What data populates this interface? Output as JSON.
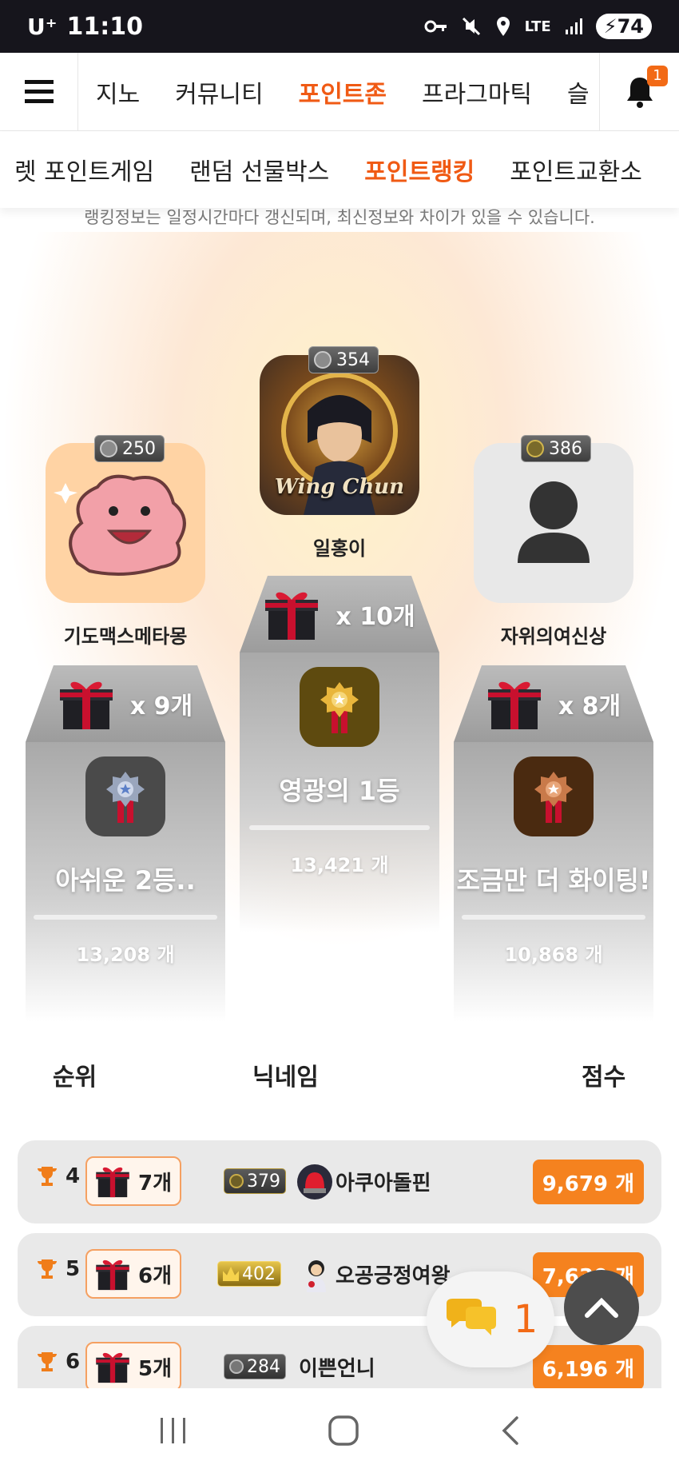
{
  "status": {
    "carrier": "U⁺",
    "time": "11:10",
    "network": "LTE",
    "battery": "74"
  },
  "nav": {
    "main_tabs": [
      "지노",
      "커뮤니티",
      "포인트존",
      "프라그마틱",
      "슬"
    ],
    "active_main": "포인트존",
    "notification_count": "1",
    "sub_tabs": [
      "렛 포인트게임",
      "랜덤 선물박스",
      "포인트랭킹",
      "포인트교환소"
    ],
    "active_sub": "포인트랭킹"
  },
  "notice": "랭킹정보는 일정시간마다 갱신되며, 최신정보와 차이가 있을 수 있습니다.",
  "podium": {
    "first": {
      "level": "354",
      "nickname": "일홍이",
      "gifts": "x 10개",
      "title": "영광의 1등",
      "score": "13,421 개",
      "avatar_text": "Wing Chun"
    },
    "second": {
      "level": "250",
      "nickname": "기도맥스메타몽",
      "gifts": "x 9개",
      "title": "아쉬운 2등..",
      "score": "13,208 개"
    },
    "third": {
      "level": "386",
      "nickname": "자위의여신상",
      "gifts": "x 8개",
      "title": "조금만 더 화이팅!",
      "score": "10,868 개"
    }
  },
  "table": {
    "headers": {
      "rank": "순위",
      "nickname": "닉네임",
      "score": "점수"
    },
    "rows": [
      {
        "rank": "4",
        "gifts": "7개",
        "level": "379",
        "nickname": "아쿠아돌핀",
        "score": "9,679 개"
      },
      {
        "rank": "5",
        "gifts": "6개",
        "level": "402",
        "nickname": "오공긍정여왕",
        "score": "7,630 개"
      },
      {
        "rank": "6",
        "gifts": "5개",
        "level": "284",
        "nickname": "이쁜언니",
        "score": "6,196 개"
      }
    ]
  },
  "chat": {
    "count": "1"
  },
  "colors": {
    "accent": "#f05a14",
    "score_bg": "#f5821f",
    "status_bg": "#16151c"
  }
}
